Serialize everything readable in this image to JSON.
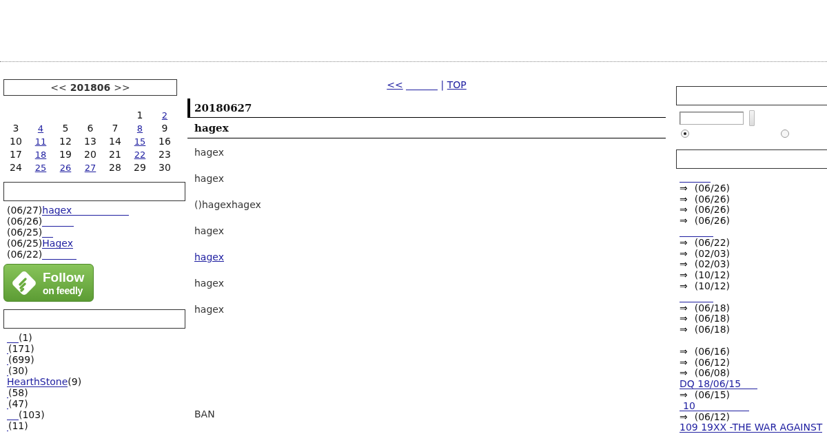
{
  "calendar": {
    "prev": "<<",
    "month": "201806",
    "next": ">>",
    "weeks": [
      [
        {
          "day": "1",
          "linked": false
        },
        {
          "day": "2",
          "linked": true
        }
      ],
      [
        {
          "day": "3",
          "linked": false
        },
        {
          "day": "4",
          "linked": true
        },
        {
          "day": "5",
          "linked": false
        },
        {
          "day": "6",
          "linked": false
        },
        {
          "day": "7",
          "linked": false
        },
        {
          "day": "8",
          "linked": true
        },
        {
          "day": "9",
          "linked": false
        }
      ],
      [
        {
          "day": "10",
          "linked": false
        },
        {
          "day": "11",
          "linked": true
        },
        {
          "day": "12",
          "linked": false
        },
        {
          "day": "13",
          "linked": false
        },
        {
          "day": "14",
          "linked": false
        },
        {
          "day": "15",
          "linked": true
        },
        {
          "day": "16",
          "linked": false
        }
      ],
      [
        {
          "day": "17",
          "linked": false
        },
        {
          "day": "18",
          "linked": true
        },
        {
          "day": "19",
          "linked": false
        },
        {
          "day": "20",
          "linked": false
        },
        {
          "day": "21",
          "linked": false
        },
        {
          "day": "22",
          "linked": true
        },
        {
          "day": "23",
          "linked": false
        }
      ],
      [
        {
          "day": "24",
          "linked": false
        },
        {
          "day": "25",
          "linked": true
        },
        {
          "day": "26",
          "linked": true
        },
        {
          "day": "27",
          "linked": true
        },
        {
          "day": "28",
          "linked": false
        },
        {
          "day": "29",
          "linked": false
        },
        {
          "day": "30",
          "linked": false
        }
      ]
    ]
  },
  "recent_entries": [
    {
      "date": "(06/27)",
      "title": "hagex"
    },
    {
      "date": "(06/26)"
    },
    {
      "date": "(06/25)"
    },
    {
      "date": "(06/25)",
      "title": "Hagex"
    },
    {
      "date": "(06/22)"
    }
  ],
  "feedly_button": {
    "label": "Follow",
    "sublabel": "on feedly"
  },
  "categories": [
    {
      "count": "(1)"
    },
    {
      "count": "(171)"
    },
    {
      "count": "(699)"
    },
    {
      "count": "(30)"
    },
    {
      "name": "HearthStone",
      "count": "(9)"
    },
    {
      "count": "(58)"
    },
    {
      "count": "(47)"
    },
    {
      "count": "(103)"
    },
    {
      "count": "(11)"
    }
  ],
  "article": {
    "nav": {
      "prev": "<<",
      "separator": "|",
      "top": "TOP"
    },
    "date": "20180627",
    "title": "hagex",
    "paragraphs": [
      {
        "kind": "text",
        "text": "hagex"
      },
      {
        "kind": "text",
        "text": "hagex"
      },
      {
        "kind": "text",
        "text": "()hagexhagex"
      },
      {
        "kind": "text",
        "text": "hagex"
      },
      {
        "kind": "link",
        "text": "hagex"
      },
      {
        "kind": "text",
        "text": "hagex"
      },
      {
        "kind": "text",
        "text": "hagex"
      }
    ],
    "closing": "BAN"
  },
  "right_sidebar": {
    "search": {
      "options": [
        {
          "selected": true
        },
        {
          "selected": false
        }
      ]
    },
    "groups": [
      {
        "kind": "linked_heading",
        "entries": [
          {
            "kind": "dated",
            "arrow": "⇒",
            "date": "(06/26)"
          },
          {
            "kind": "dated",
            "arrow": "⇒",
            "date": "(06/26)"
          },
          {
            "kind": "dated",
            "arrow": "⇒",
            "date": "(06/26)"
          },
          {
            "kind": "dated",
            "arrow": "⇒",
            "date": "(06/26)"
          }
        ]
      },
      {
        "kind": "linked_heading",
        "entries": [
          {
            "kind": "dated",
            "arrow": "⇒",
            "date": "(06/22)"
          },
          {
            "kind": "dated",
            "arrow": "⇒",
            "date": "(02/03)"
          },
          {
            "kind": "dated",
            "arrow": "⇒",
            "date": "(02/03)"
          },
          {
            "kind": "dated",
            "arrow": "⇒",
            "date": "(10/12)"
          },
          {
            "kind": "dated",
            "arrow": "⇒",
            "date": "(10/12)"
          }
        ]
      },
      {
        "kind": "linked_heading",
        "entries": [
          {
            "kind": "dated",
            "arrow": "⇒",
            "date": "(06/18)"
          },
          {
            "kind": "dated",
            "arrow": "⇒",
            "date": "(06/18)"
          },
          {
            "kind": "dated",
            "arrow": "⇒",
            "date": "(06/18)"
          }
        ]
      },
      {
        "kind": "plain_heading",
        "entries": [
          {
            "kind": "dated",
            "arrow": "⇒",
            "date": "(06/16)"
          },
          {
            "kind": "dated",
            "arrow": "⇒",
            "date": "(06/12)"
          },
          {
            "kind": "dated",
            "arrow": "⇒",
            "date": "(06/08)"
          },
          {
            "kind": "link",
            "text": "DQ 18/06/15"
          },
          {
            "kind": "dated",
            "arrow": "⇒",
            "date": "(06/15)"
          },
          {
            "kind": "link",
            "text": "10"
          },
          {
            "kind": "dated",
            "arrow": "⇒",
            "date": "(06/12)"
          },
          {
            "kind": "link",
            "text": "109 19XX -THE WAR AGAINST"
          }
        ]
      }
    ]
  }
}
